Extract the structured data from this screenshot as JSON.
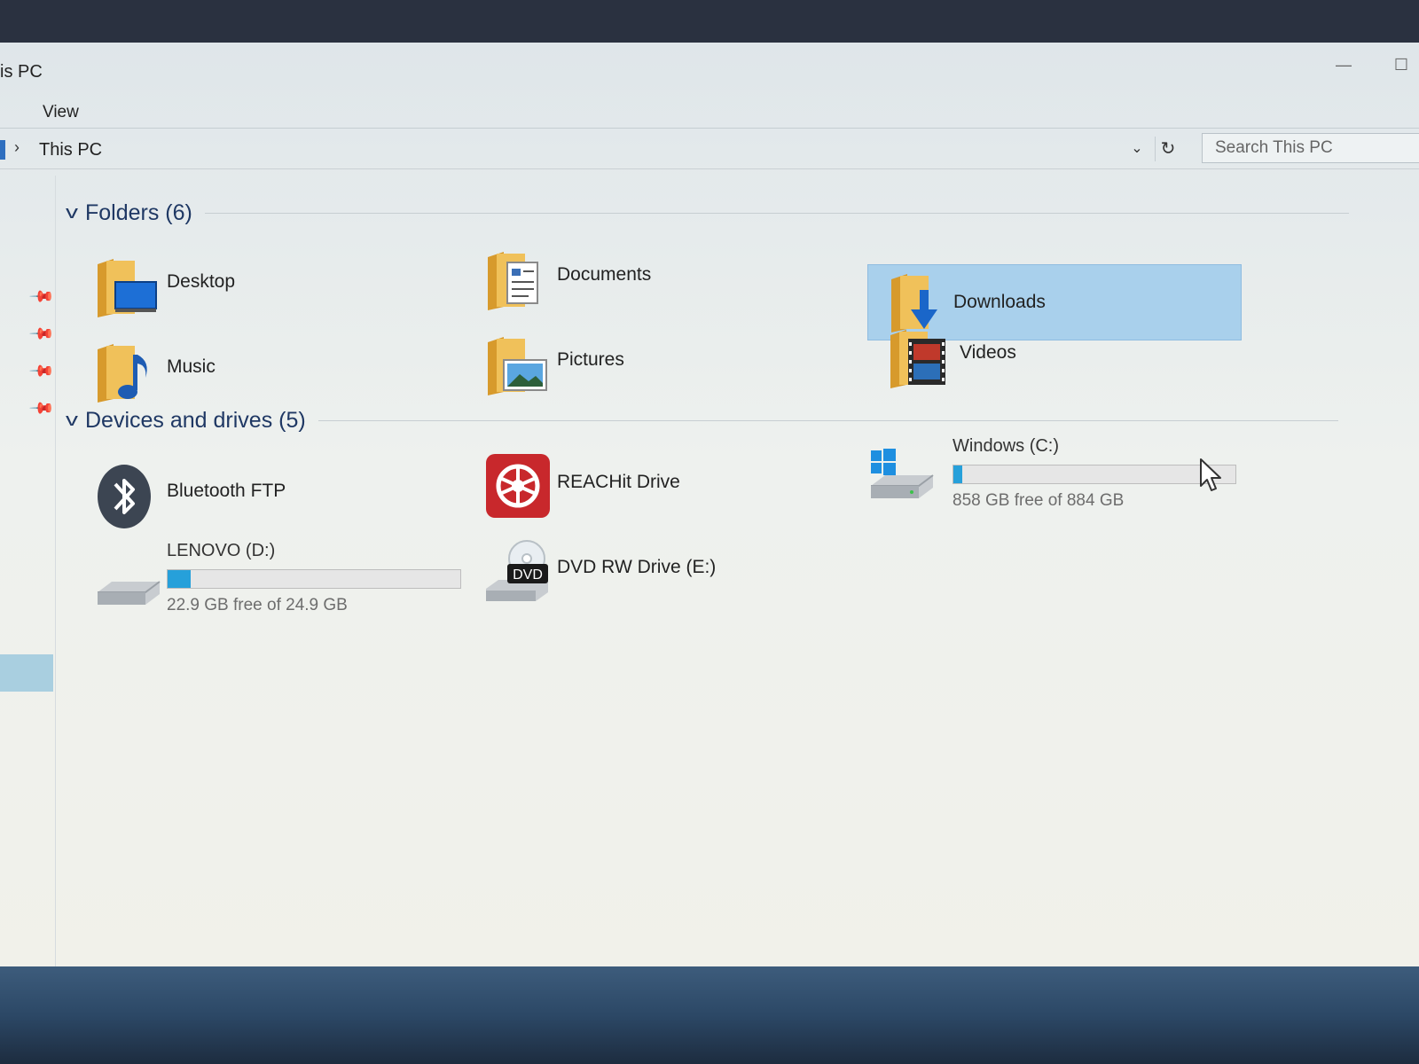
{
  "window": {
    "title": "is PC",
    "minimize_glyph": "—",
    "maximize_glyph": "☐"
  },
  "menu": {
    "view_label": "View"
  },
  "address": {
    "crumb_sep": "›",
    "path": "This PC",
    "dropdown_glyph": "⌄",
    "refresh_glyph": "↻"
  },
  "search": {
    "placeholder": "Search This PC"
  },
  "nav_pane": {
    "pins": 4,
    "pin_glyph": "📌"
  },
  "folders": {
    "header": "Folders (6)",
    "items": [
      {
        "label": "Desktop",
        "icon": "desktop-folder-icon"
      },
      {
        "label": "Documents",
        "icon": "documents-folder-icon"
      },
      {
        "label": "Downloads",
        "icon": "downloads-folder-icon",
        "selected": true
      },
      {
        "label": "Music",
        "icon": "music-folder-icon"
      },
      {
        "label": "Pictures",
        "icon": "pictures-folder-icon"
      },
      {
        "label": "Videos",
        "icon": "videos-folder-icon"
      }
    ]
  },
  "devices": {
    "header": "Devices and drives (5)",
    "items": [
      {
        "label": "Bluetooth FTP",
        "icon": "bluetooth-icon"
      },
      {
        "label": "REACHit Drive",
        "icon": "reachit-drive-icon"
      },
      {
        "label": "Windows (C:)",
        "icon": "windows-drive-icon",
        "free_text": "858 GB free of 884 GB",
        "used_fraction": 0.029
      },
      {
        "label": "LENOVO (D:)",
        "icon": "hard-drive-icon",
        "free_text": "22.9 GB free of 24.9 GB",
        "used_fraction": 0.08
      },
      {
        "label": "DVD RW Drive (E:)",
        "icon": "dvd-drive-icon",
        "badge": "DVD"
      }
    ]
  },
  "colors": {
    "accent": "#26a0da",
    "selection": "#a9d0ec",
    "header_text": "#1f3864",
    "folder": "#e8b64c"
  }
}
